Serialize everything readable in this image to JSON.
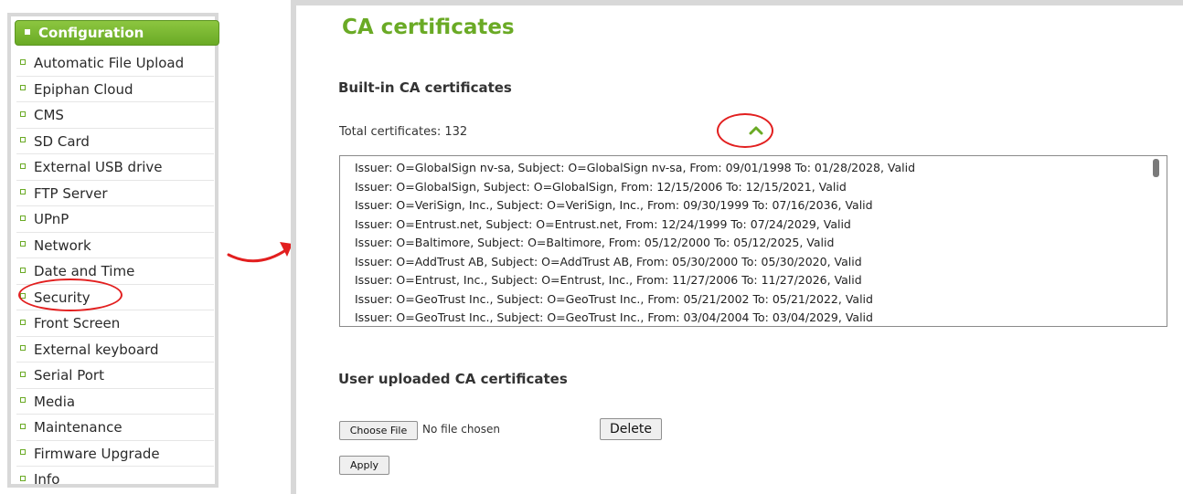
{
  "sidebar": {
    "header": "Configuration",
    "items": [
      {
        "label": "Automatic File Upload"
      },
      {
        "label": "Epiphan Cloud"
      },
      {
        "label": "CMS"
      },
      {
        "label": "SD Card"
      },
      {
        "label": "External USB drive"
      },
      {
        "label": "FTP Server"
      },
      {
        "label": "UPnP"
      },
      {
        "label": "Network"
      },
      {
        "label": "Date and Time"
      },
      {
        "label": "Security"
      },
      {
        "label": "Front Screen"
      },
      {
        "label": "External keyboard"
      },
      {
        "label": "Serial Port"
      },
      {
        "label": "Media"
      },
      {
        "label": "Maintenance"
      },
      {
        "label": "Firmware Upgrade"
      },
      {
        "label": "Info"
      }
    ],
    "highlighted_item": "Security"
  },
  "main": {
    "title": "CA certificates",
    "builtin": {
      "title": "Built-in CA certificates",
      "total_label": "Total certificates: 132",
      "collapse_icon": "chevron-up-icon",
      "certificates": [
        "Issuer: O=GlobalSign nv-sa, Subject: O=GlobalSign nv-sa, From: 09/01/1998 To: 01/28/2028, Valid",
        "Issuer: O=GlobalSign, Subject: O=GlobalSign, From: 12/15/2006 To: 12/15/2021, Valid",
        "Issuer: O=VeriSign, Inc., Subject: O=VeriSign, Inc., From: 09/30/1999 To: 07/16/2036, Valid",
        "Issuer: O=Entrust.net, Subject: O=Entrust.net, From: 12/24/1999 To: 07/24/2029, Valid",
        "Issuer: O=Baltimore, Subject: O=Baltimore, From: 05/12/2000 To: 05/12/2025, Valid",
        "Issuer: O=AddTrust AB, Subject: O=AddTrust AB, From: 05/30/2000 To: 05/30/2020, Valid",
        "Issuer: O=Entrust, Inc., Subject: O=Entrust, Inc., From: 11/27/2006 To: 11/27/2026, Valid",
        "Issuer: O=GeoTrust Inc., Subject: O=GeoTrust Inc., From: 05/21/2002 To: 05/21/2022, Valid",
        "Issuer: O=GeoTrust Inc., Subject: O=GeoTrust Inc., From: 03/04/2004 To: 03/04/2029, Valid"
      ]
    },
    "user": {
      "title": "User uploaded CA certificates",
      "choose_file_label": "Choose File",
      "no_file_text": "No file chosen",
      "delete_label": "Delete",
      "apply_label": "Apply"
    }
  },
  "colors": {
    "accent_green": "#6aaa25",
    "highlight_red": "#e21f1f",
    "panel_border": "#d8d8d8"
  }
}
